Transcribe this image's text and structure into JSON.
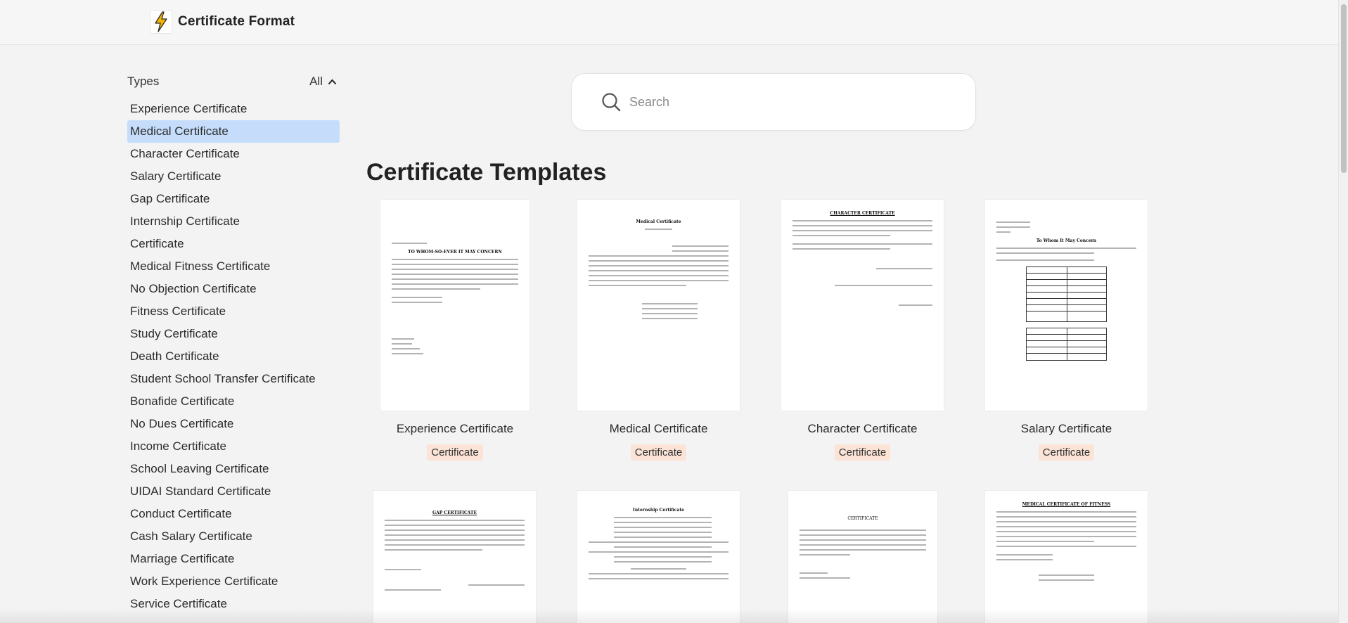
{
  "header": {
    "title": "Certificate Format",
    "logo_icon": "lightning-bolt-icon",
    "accent": "#f4b400"
  },
  "sidebar": {
    "heading": "Types",
    "filter_label": "All",
    "active_bg": "#c5ddfb",
    "items": [
      "Experience Certificate",
      "Medical Certificate",
      "Character Certificate",
      "Salary Certificate",
      "Gap Certificate",
      "Internship Certificate",
      "Certificate",
      "Medical Fitness Certificate",
      "No Objection Certificate",
      "Fitness Certificate",
      "Study Certificate",
      "Death Certificate",
      "Student School Transfer Certificate",
      "Bonafide Certificate",
      "No Dues Certificate",
      "Income Certificate",
      "School Leaving Certificate",
      "UIDAI Standard Certificate",
      "Conduct Certificate",
      "Cash Salary Certificate",
      "Marriage Certificate",
      "Work Experience Certificate",
      "Service Certificate"
    ],
    "active_index": 1
  },
  "search": {
    "placeholder": "Search",
    "icon": "search-icon"
  },
  "main": {
    "title": "Certificate Templates",
    "badge_color": "#fbe3d6",
    "cards": [
      {
        "title": "Experience Certificate",
        "badge": "Certificate",
        "doc_heading": "TO WHOM-SO-EVER IT MAY CONCERN"
      },
      {
        "title": "Medical Certificate",
        "badge": "Certificate",
        "doc_heading": "Medical Certificate"
      },
      {
        "title": "Character Certificate",
        "badge": "Certificate",
        "doc_heading": "CHARACTER CERTIFICATE"
      },
      {
        "title": "Salary Certificate",
        "badge": "Certificate",
        "doc_heading": "To Whom It May Concern"
      },
      {
        "doc_heading": "GAP CERTIFICATE"
      },
      {
        "doc_heading": "Internship Certificate"
      },
      {
        "doc_heading": "CERTIFICATE"
      },
      {
        "doc_heading": "MEDICAL CERTIFICATE OF FITNESS"
      }
    ]
  }
}
